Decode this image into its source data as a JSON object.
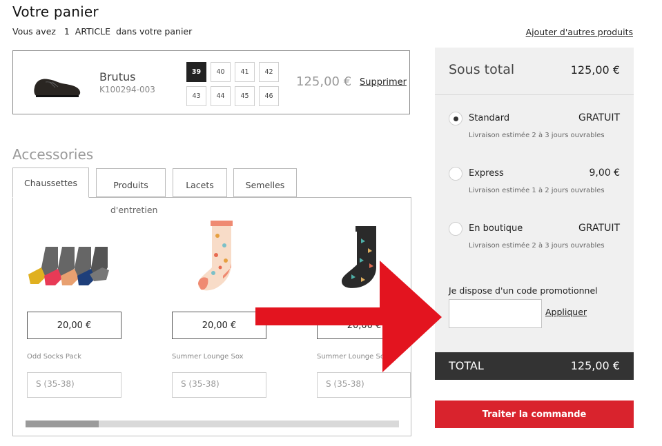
{
  "header": {
    "title": "Votre panier",
    "subtitle": "Vous avez   1  ARTICLE  dans votre panier",
    "add_link": "Ajouter d'autres produits"
  },
  "cart_item": {
    "name": "Brutus",
    "reference": "K100294-003",
    "sizes": [
      "39",
      "40",
      "41",
      "42",
      "43",
      "44",
      "45",
      "46"
    ],
    "selected_size": "39",
    "price": "125,00 €",
    "remove_label": "Supprimer",
    "image_icon": "shoe-image"
  },
  "accessories": {
    "title": "Accessories",
    "tabs": [
      {
        "label": "Chaussettes"
      },
      {
        "label": "Produits"
      },
      {
        "label": "Lacets"
      },
      {
        "label": "Semelles"
      }
    ],
    "tab_overflow_text": "d'entretien",
    "items": [
      {
        "price": "20,00 €",
        "name": "Odd Socks Pack",
        "size_placeholder": "S (35-38)"
      },
      {
        "price": "20,00 €",
        "name": "Summer Lounge Sox",
        "size_placeholder": "S (35-38)"
      },
      {
        "price": "20,00 €",
        "name": "Summer Lounge Sox",
        "size_placeholder": "S (35-38)"
      }
    ],
    "scroll_position": 0.0
  },
  "summary": {
    "subtotal_label": "Sous total",
    "subtotal_value": "125,00 €",
    "shipping_options": [
      {
        "name": "Standard",
        "price": "GRATUIT",
        "note": "Livraison estimée 2 à 3 jours ouvrables",
        "selected": true
      },
      {
        "name": "Express",
        "price": "9,00 €",
        "note": "Livraison estimée 1 à 2 jours ouvrables",
        "selected": false
      },
      {
        "name": "En boutique",
        "price": "GRATUIT",
        "note": "Livraison estimée 2 à 3 jours ouvrables",
        "selected": false
      }
    ],
    "promo_label": "Je dispose d'un code promotionnel",
    "promo_value": "",
    "promo_apply": "Appliquer",
    "total_label": "TOTAL",
    "total_value": "125,00 €",
    "checkout_label": "Traiter la commande"
  },
  "colors": {
    "accent_red": "#d9232d",
    "total_bar": "#333333",
    "summary_bg": "#f0f0f0",
    "annotation_arrow": "#e3141f"
  }
}
